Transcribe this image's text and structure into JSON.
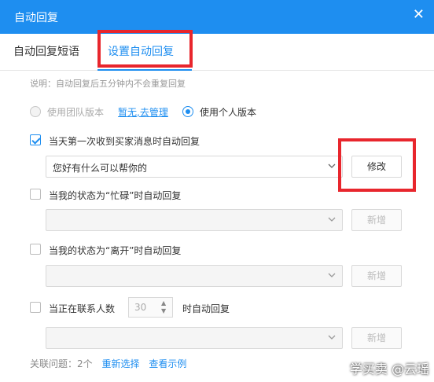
{
  "window": {
    "title": "自动回复",
    "close_glyph": "✕"
  },
  "tabs": [
    {
      "label": "自动回复短语"
    },
    {
      "label": "设置自动回复"
    }
  ],
  "note": "说明：自动回复后五分钟内不会重复回复",
  "version": {
    "team_label": "使用团队版本",
    "team_link": "暂无,去管理",
    "personal_label": "使用个人版本",
    "selected": "personal"
  },
  "rules": [
    {
      "label": "当天第一次收到买家消息时自动回复",
      "checked": true,
      "select_value": "您好有什么可以帮你的",
      "button": "修改"
    },
    {
      "label": "当我的状态为“忙碌”时自动回复",
      "checked": false,
      "select_value": "",
      "button": "新增"
    },
    {
      "label": "当我的状态为“离开”时自动回复",
      "checked": false,
      "select_value": "",
      "button": "新增"
    },
    {
      "label_before": "当正在联系人数",
      "number_value": "30",
      "label_after": "时自动回复",
      "checked": false,
      "select_value": "",
      "button": "新增"
    }
  ],
  "footer": {
    "related": "关联问题：2个",
    "reselect": "重新选择",
    "view_example": "查看示例"
  },
  "watermark": "学买卖 @云瑶",
  "colors": {
    "accent": "#1e8ef0",
    "highlight": "#e8262d"
  }
}
